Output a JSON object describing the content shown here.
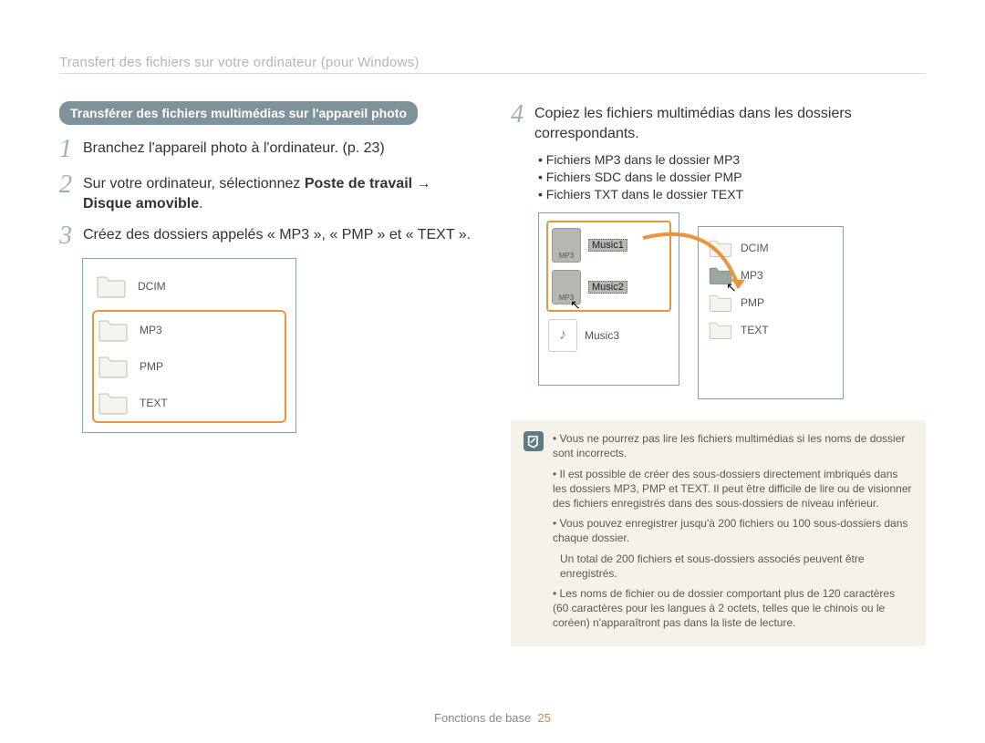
{
  "breadcrumb": "Transfert des fichiers sur votre ordinateur (pour Windows)",
  "heading": "Transférer des fichiers multimédias sur l'appareil photo",
  "steps_left": [
    {
      "num": "1",
      "text": "Branchez l'appareil photo à l'ordinateur. (p. 23)"
    },
    {
      "num": "2",
      "html_pre": "Sur votre ordinateur, sélectionnez ",
      "bold1": "Poste de travail",
      "arrow": " → ",
      "bold2": "Disque amovible",
      "post": "."
    },
    {
      "num": "3",
      "text": "Créez des dossiers appelés « MP3 », « PMP » et « TEXT »."
    }
  ],
  "left_fig": {
    "top": "DCIM",
    "highlighted": [
      "MP3",
      "PMP",
      "TEXT"
    ]
  },
  "step4": {
    "num": "4",
    "text": "Copiez les fichiers multimédias dans les dossiers correspondants."
  },
  "sub_bullets": [
    "Fichiers MP3 dans le dossier MP3",
    "Fichiers SDC dans le dossier PMP",
    "Fichiers TXT dans le dossier TEXT"
  ],
  "right_fig": {
    "source_items": [
      {
        "label": "Music1",
        "icon": "mp3",
        "selected": true
      },
      {
        "label": "Music2",
        "icon": "mp3",
        "selected": true
      },
      {
        "label": "Music3",
        "icon": "note",
        "selected": false
      }
    ],
    "dest_items": [
      "DCIM",
      "MP3",
      "PMP",
      "TEXT"
    ],
    "mp3_icon_text": "MP3"
  },
  "notes": [
    {
      "bullet": true,
      "text": "Vous ne pourrez pas lire les fichiers multimédias si les noms de dossier sont incorrects."
    },
    {
      "bullet": true,
      "text": "Il est possible de créer des sous-dossiers directement imbriqués dans les dossiers MP3, PMP et TEXT. Il peut être difficile de lire ou de visionner des fichiers enregistrés dans des sous-dossiers de niveau inférieur."
    },
    {
      "bullet": true,
      "text": "Vous pouvez enregistrer jusqu'à 200 fichiers ou 100 sous-dossiers dans chaque dossier."
    },
    {
      "bullet": false,
      "text": "Un total de 200 fichiers et sous-dossiers associés peuvent être enregistrés."
    },
    {
      "bullet": true,
      "text": "Les noms de fichier ou de dossier comportant plus de 120 caractères (60 caractères pour les langues à 2 octets, telles que le chinois ou le coréen) n'apparaîtront pas dans la liste de lecture."
    }
  ],
  "footer": {
    "label": "Fonctions de base",
    "page": "25"
  }
}
